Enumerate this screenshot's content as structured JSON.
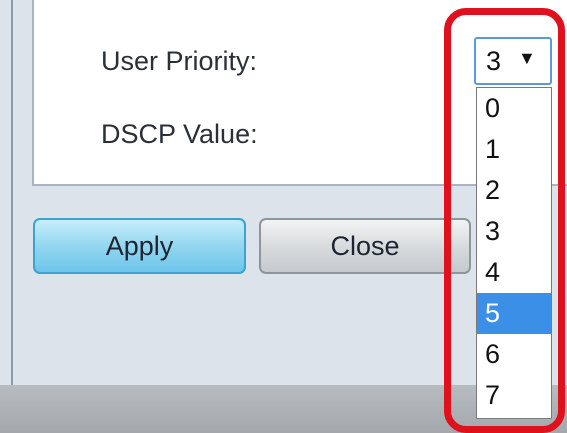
{
  "form": {
    "user_priority_label": "User Priority:",
    "dscp_value_label": "DSCP Value:"
  },
  "user_priority_select": {
    "selected_value": "3",
    "arrow_glyph": "▼",
    "options": [
      "0",
      "1",
      "2",
      "3",
      "4",
      "5",
      "6",
      "7"
    ],
    "highlighted_option": "5"
  },
  "buttons": {
    "apply_label": "Apply",
    "close_label": "Close"
  },
  "colors": {
    "annotation_highlight": "#e1101d",
    "selected_option_bg": "#3b8fe6",
    "apply_button": "#8fd4ef"
  }
}
